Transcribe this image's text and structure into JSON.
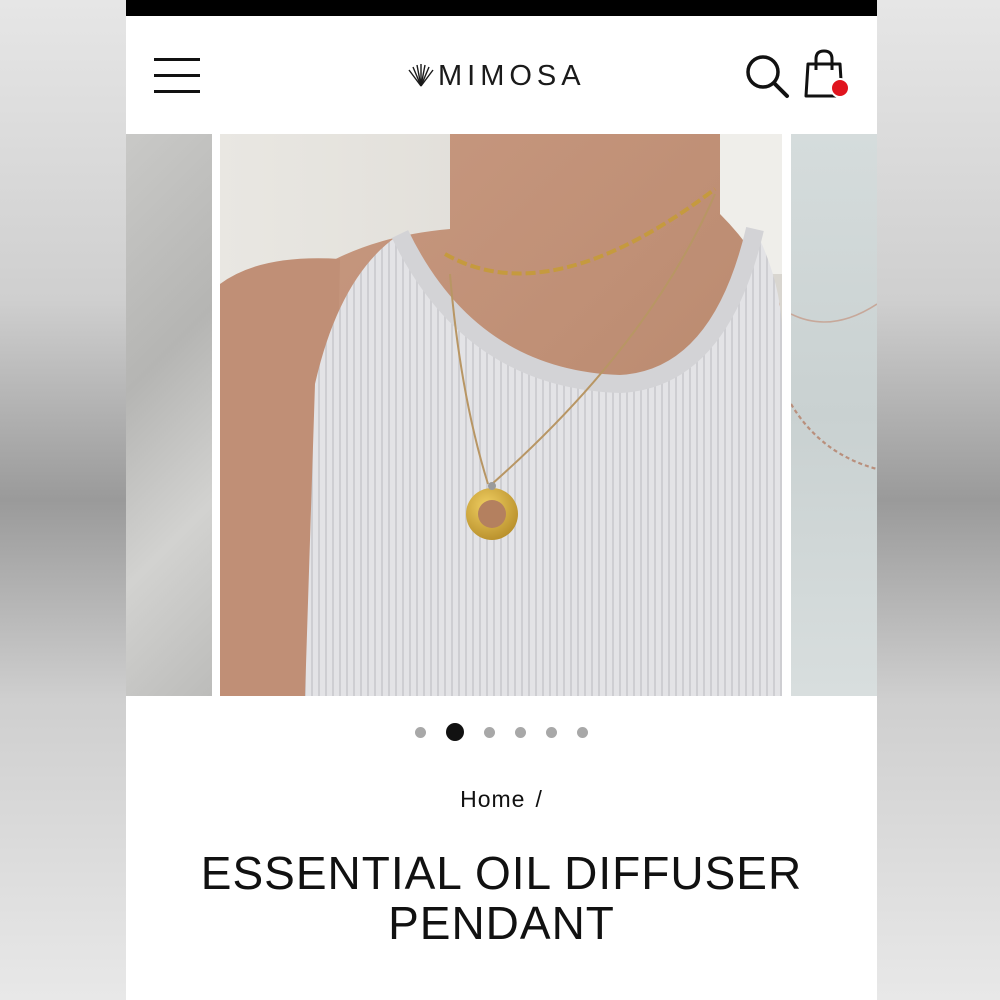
{
  "header": {
    "brand": "MIMOSA",
    "icons": {
      "menu": "hamburger-menu-icon",
      "search": "search-icon",
      "cart": "shopping-bag-icon"
    },
    "cart_badge_color": "#e0141e"
  },
  "gallery": {
    "slide_count": 6,
    "active_slide": 2,
    "zoom_icon": "zoom-search-icon"
  },
  "breadcrumb": {
    "home": "Home",
    "separator": "/"
  },
  "product": {
    "title_line1": "ESSENTIAL OIL DIFFUSER",
    "title_line2": "PENDANT"
  }
}
